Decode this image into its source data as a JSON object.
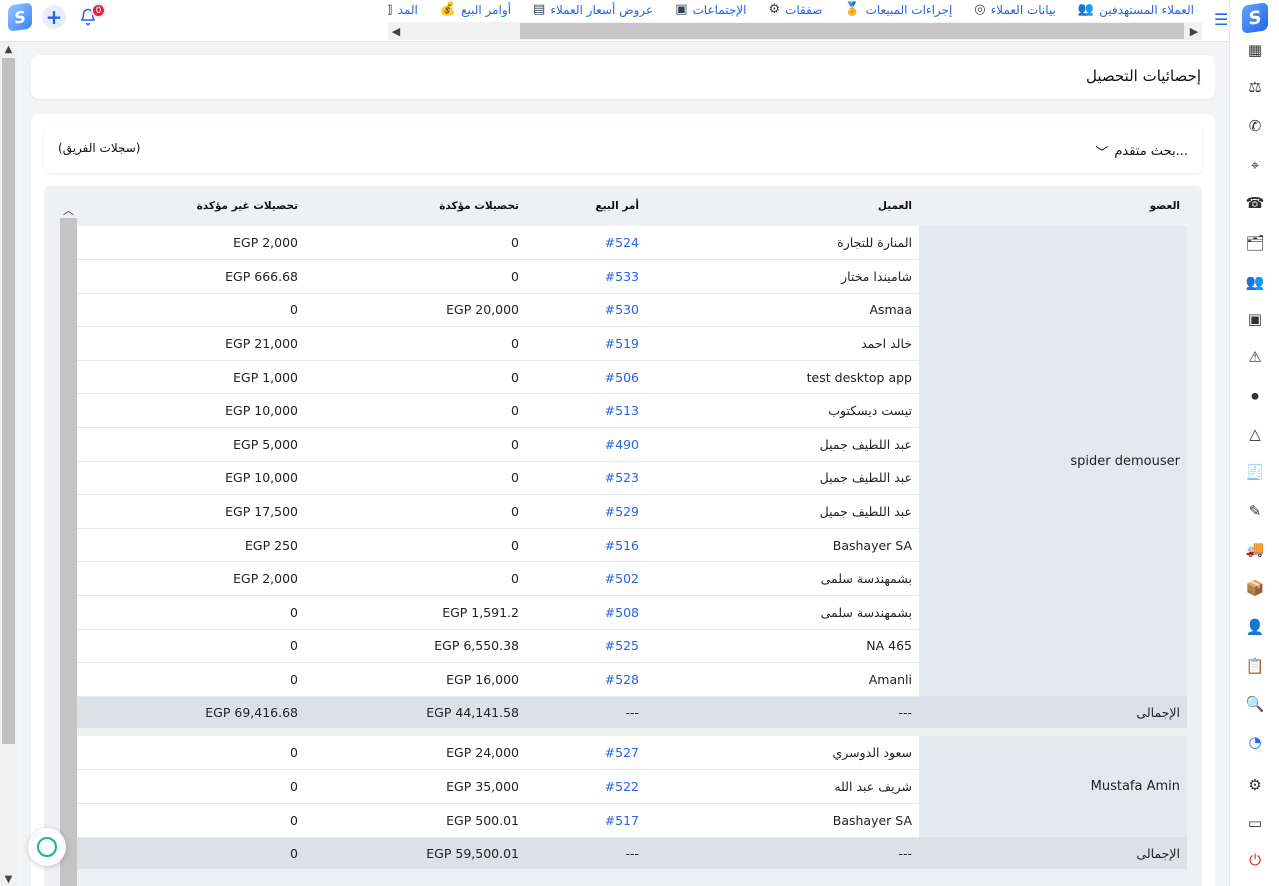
{
  "topbar": {
    "notification_count": "0",
    "nav_items": [
      {
        "label": "العملاء المستهدفين",
        "icon": "target-customers-icon"
      },
      {
        "label": "بيانات العملاء",
        "icon": "customer-data-icon"
      },
      {
        "label": "إجراءات المبيعات",
        "icon": "sales-actions-icon"
      },
      {
        "label": "صفقات",
        "icon": "deals-icon"
      },
      {
        "label": "الإجتماعات",
        "icon": "meetings-icon"
      },
      {
        "label": "عروض أسعار العملاء",
        "icon": "quotations-icon"
      },
      {
        "label": "أوامر البيع",
        "icon": "sales-orders-icon"
      },
      {
        "label": "المد",
        "icon": "supply-icon"
      }
    ]
  },
  "page": {
    "title": "إحصائيات التحصيل",
    "advanced_search": "بحث متقدم...",
    "team_records": "(سجلات الفريق)"
  },
  "table": {
    "headers": {
      "member": "العضو",
      "customer": "العميل",
      "sales_order": "أمر البيع",
      "confirmed": "تحصيلات مؤكدة",
      "unconfirmed": "تحصيلات غير مؤكدة"
    },
    "groups": [
      {
        "member": "spider demouser",
        "rows": [
          {
            "customer": "المنارة للتجارة",
            "order": "#524",
            "confirmed": "0",
            "unconfirmed": "EGP 2,000"
          },
          {
            "customer": "شاميندا مختار",
            "order": "#533",
            "confirmed": "0",
            "unconfirmed": "EGP 666.68"
          },
          {
            "customer": "Asmaa",
            "order": "#530",
            "confirmed": "EGP 20,000",
            "unconfirmed": "0"
          },
          {
            "customer": "خالد احمد",
            "order": "#519",
            "confirmed": "0",
            "unconfirmed": "EGP 21,000"
          },
          {
            "customer": "test desktop app",
            "order": "#506",
            "confirmed": "0",
            "unconfirmed": "EGP 1,000"
          },
          {
            "customer": "تيست ديسكتوب",
            "order": "#513",
            "confirmed": "0",
            "unconfirmed": "EGP 10,000"
          },
          {
            "customer": "عبد اللطيف جميل",
            "order": "#490",
            "confirmed": "0",
            "unconfirmed": "EGP 5,000"
          },
          {
            "customer": "عبد اللطيف جميل",
            "order": "#523",
            "confirmed": "0",
            "unconfirmed": "EGP 10,000"
          },
          {
            "customer": "عبد اللطيف جميل",
            "order": "#529",
            "confirmed": "0",
            "unconfirmed": "EGP 17,500"
          },
          {
            "customer": "Bashayer SA",
            "order": "#516",
            "confirmed": "0",
            "unconfirmed": "EGP 250"
          },
          {
            "customer": "بشمهندسة سلمى",
            "order": "#502",
            "confirmed": "0",
            "unconfirmed": "EGP 2,000"
          },
          {
            "customer": "بشمهندسة سلمى",
            "order": "#508",
            "confirmed": "EGP 1,591.2",
            "unconfirmed": "0"
          },
          {
            "customer": "NA 465",
            "order": "#525",
            "confirmed": "EGP 6,550.38",
            "unconfirmed": "0"
          },
          {
            "customer": "Amanli",
            "order": "#528",
            "confirmed": "EGP 16,000",
            "unconfirmed": "0"
          }
        ],
        "total": {
          "label": "الإجمالى",
          "customer": "---",
          "order": "---",
          "confirmed": "EGP 44,141.58",
          "unconfirmed": "EGP 69,416.68"
        }
      },
      {
        "member": "Mustafa Amin",
        "rows": [
          {
            "customer": "سعود الدوسري",
            "order": "#527",
            "confirmed": "EGP 24,000",
            "unconfirmed": "0"
          },
          {
            "customer": "شريف عبد الله",
            "order": "#522",
            "confirmed": "EGP 35,000",
            "unconfirmed": "0"
          },
          {
            "customer": "Bashayer SA",
            "order": "#517",
            "confirmed": "EGP 500.01",
            "unconfirmed": "0"
          }
        ],
        "total": {
          "label": "الإجمالى",
          "customer": "---",
          "order": "---",
          "confirmed": "EGP 59,500.01",
          "unconfirmed": "0"
        }
      }
    ]
  },
  "sidebar": {
    "icons": [
      "building-icon",
      "gavel-icon",
      "phone-call-icon",
      "crosshair-icon",
      "telephone-icon",
      "user-folder-icon",
      "team-icon",
      "cash-icon",
      "warning-icon",
      "video-icon",
      "mountain-icon",
      "invoice-icon",
      "pen-icon",
      "truck-icon",
      "box-icon",
      "user-support-icon",
      "report-icon",
      "document-search-icon",
      "statistics-icon",
      "gear-icon",
      "tablet-icon",
      "power-icon"
    ]
  },
  "colors": {
    "accent": "#2563eb",
    "danger": "#dc2626",
    "success": "#10b981"
  }
}
